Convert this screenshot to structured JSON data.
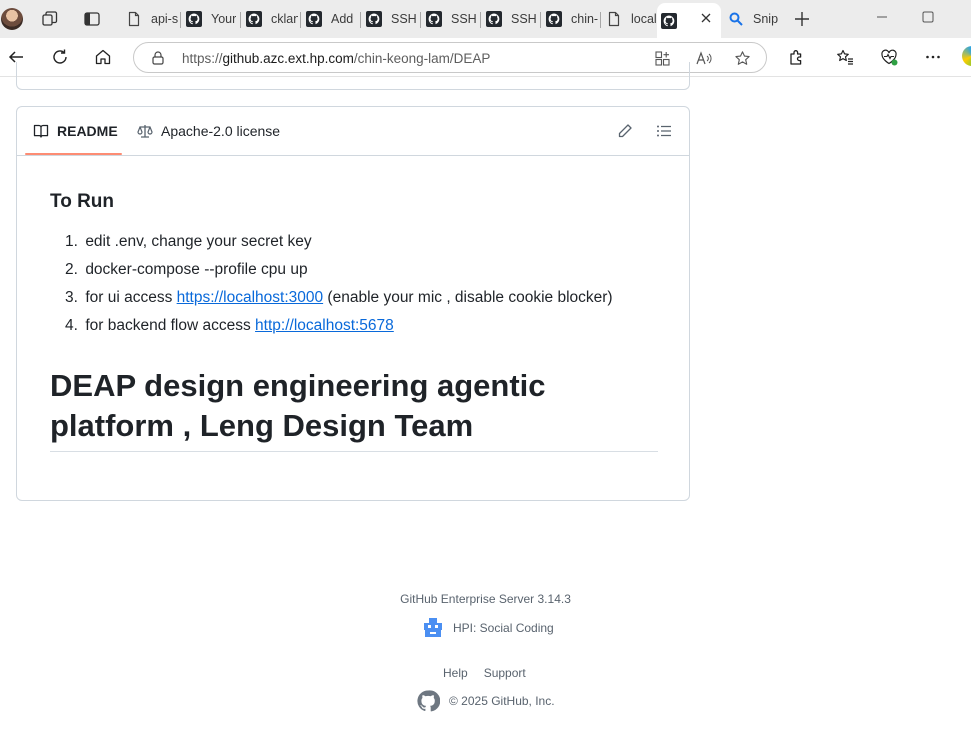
{
  "browser": {
    "tabs": [
      {
        "label": "api-s",
        "icon": "document-icon"
      },
      {
        "label": "Your",
        "icon": "github-icon"
      },
      {
        "label": "cklan",
        "icon": "github-icon"
      },
      {
        "label": "Add",
        "icon": "github-icon"
      },
      {
        "label": "SSH",
        "icon": "github-icon"
      },
      {
        "label": "SSH",
        "icon": "github-icon"
      },
      {
        "label": "SSH",
        "icon": "github-icon"
      },
      {
        "label": "chin-",
        "icon": "github-icon"
      },
      {
        "label": "local",
        "icon": "document-icon"
      },
      {
        "label": "",
        "icon": "github-icon",
        "active": true
      },
      {
        "label": "Snip",
        "icon": "search-icon"
      }
    ],
    "url": {
      "scheme": "https://",
      "host": "github.azc.ext.hp.com",
      "path": "/chin-keong-lam/DEAP"
    }
  },
  "readme": {
    "tabs": {
      "readme": "README",
      "license": "Apache-2.0 license"
    },
    "run_heading": "To Run",
    "steps": [
      {
        "num": "1.",
        "text": "edit .env, change your secret key",
        "link": "",
        "after": ""
      },
      {
        "num": "2.",
        "text": "docker-compose --profile cpu up",
        "link": "",
        "after": ""
      },
      {
        "num": "3.",
        "text": "for ui access ",
        "link": "https://localhost:3000",
        "after": " (enable your mic , disable cookie blocker)"
      },
      {
        "num": "4.",
        "text": "for backend flow access ",
        "link": "http://localhost:5678",
        "after": ""
      }
    ],
    "title": "DEAP design engineering agentic platform , Leng Design Team"
  },
  "footer": {
    "server": "GitHub Enterprise Server 3.14.3",
    "social": "HPI: Social Coding",
    "links": [
      "Help",
      "Support"
    ],
    "copyright": "© 2025 GitHub, Inc."
  },
  "colors": {
    "link": "#0969da",
    "tab_accent": "#fd8c73",
    "border": "#d0d7de"
  }
}
